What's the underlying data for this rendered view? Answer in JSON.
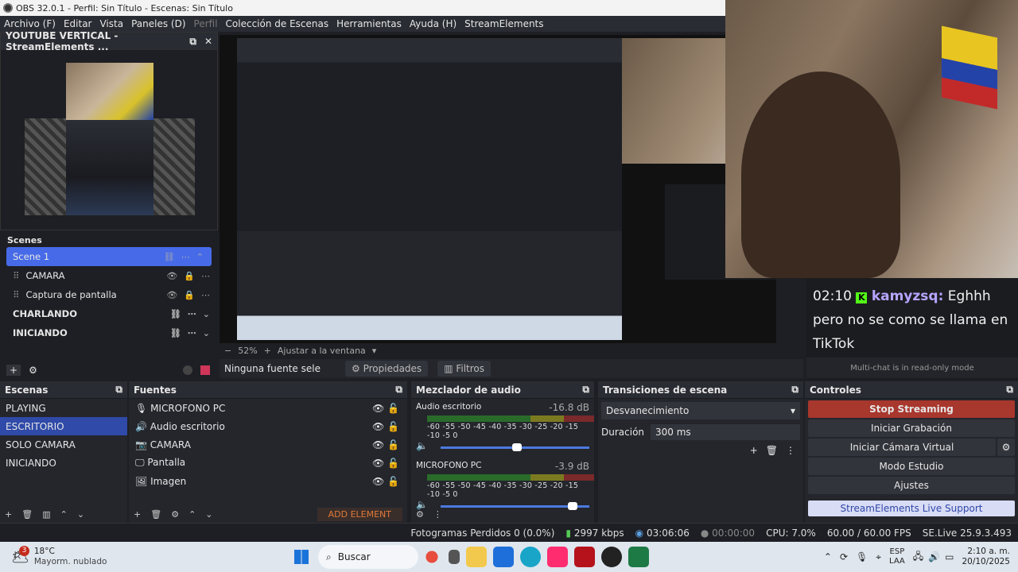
{
  "window": {
    "title": "OBS 32.0.1 - Perfil: Sin Título - Escenas: Sin Título"
  },
  "menu": [
    "Archivo (F)",
    "Editar",
    "Vista",
    "Paneles (D)",
    "Perfil",
    "Colección de Escenas",
    "Herramientas",
    "Ayuda (H)",
    "StreamElements"
  ],
  "multiscene": {
    "title": "YOUTUBE VERTICAL - StreamElements ...",
    "scenes_label": "Scenes",
    "scene1": "Scene 1",
    "src1": "CAMARA",
    "src2": "Captura de pantalla",
    "charlando": "CHARLANDO",
    "iniciando": "INICIANDO"
  },
  "preview": {
    "zoom": "52%",
    "fit": "Ajustar a la ventana"
  },
  "ctx": {
    "no_source": "Ninguna fuente sele",
    "props": "Propiedades",
    "filters": "Filtros"
  },
  "chat": {
    "time": "02:10",
    "user": "kamyzsq:",
    "message": "Eghhh pero no se como se llama en TikTok",
    "footer": "Multi-chat is in read-only mode"
  },
  "scenes": {
    "title": "Escenas",
    "items": [
      "PLAYING",
      "ESCRITORIO",
      "SOLO CAMARA",
      "INICIANDO"
    ],
    "selected": 1
  },
  "sources": {
    "title": "Fuentes",
    "items": [
      {
        "name": "MICROFONO PC",
        "icon": "mic-icon"
      },
      {
        "name": "Audio escritorio",
        "icon": "speaker-icon"
      },
      {
        "name": "CAMARA",
        "icon": "camera-icon"
      },
      {
        "name": "Pantalla",
        "icon": "monitor-icon"
      },
      {
        "name": "Imagen",
        "icon": "image-icon"
      }
    ],
    "add_element": "ADD ELEMENT"
  },
  "mixer": {
    "title": "Mezclador de audio",
    "channels": [
      {
        "name": "Audio escritorio",
        "db": "-16.8 dB",
        "level": 0.47
      },
      {
        "name": "MICROFONO PC",
        "db": "-3.9 dB",
        "level": 0.81
      }
    ],
    "ticks": "-60 -55 -50 -45 -40 -35 -30 -25 -20 -15 -10 -5  0"
  },
  "transitions": {
    "title": "Transiciones de escena",
    "selected": "Desvanecimiento",
    "duration_label": "Duración",
    "duration": "300 ms"
  },
  "controls": {
    "title": "Controles",
    "stop": "Stop Streaming",
    "record": "Iniciar Grabación",
    "vcam": "Iniciar Cámara Virtual",
    "studio": "Modo Estudio",
    "settings": "Ajustes",
    "support": "StreamElements Live Support"
  },
  "status": {
    "dropped": "Fotogramas Perdidos 0 (0.0%)",
    "kbps": "2997 kbps",
    "stream_time": "03:06:06",
    "rec_time": "00:00:00",
    "cpu": "CPU: 7.0%",
    "fps": "60.00 / 60.00 FPS",
    "se": "SE.Live 25.9.3.493"
  },
  "taskbar": {
    "weather_temp": "18°C",
    "weather_desc": "Mayorm. nublado",
    "weather_badge": "3",
    "search": "Buscar",
    "lang1": "ESP",
    "lang2": "LAA",
    "time": "2:10 a. m.",
    "date": "20/10/2025"
  },
  "colors": {
    "accent": "#476be8",
    "stop": "#a8372d",
    "support": "#d8dcf5"
  }
}
